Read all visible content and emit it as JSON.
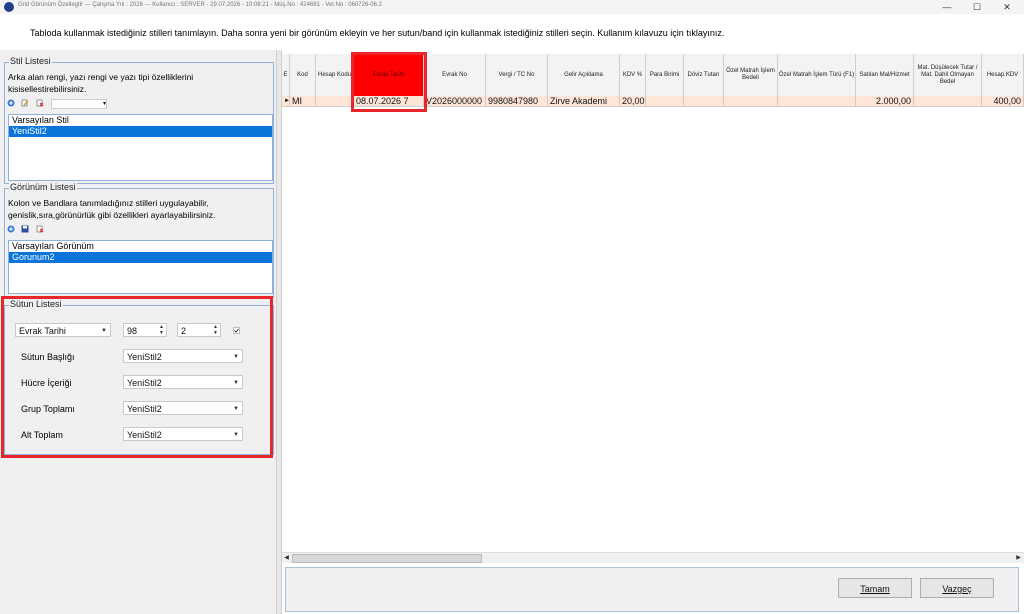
{
  "window": {
    "title": "Grid Görünüm Özellegtir  ---  Çalışma Yılı : 2026  ---  Kullanıcı : SERVER - 29.07.2026 - 10:08:21 - Müş.No : 424681 - Ver.No : 060726-06.2",
    "minimize": "—",
    "maximize": "☐",
    "close": "✕"
  },
  "instruction": "Tabloda kullanmak istediğiniz stilleri tanımlayın. Daha sonra  yeni bir görünüm ekleyin ve her sutun/band için kullanmak istediğiniz stilleri seçin. Kullanım kılavuzu için tıklayınız.",
  "stil_listesi": {
    "title": "Stil Listesi",
    "desc": "Arka alan rengi, yazı rengi ve yazı tipi özelliklerini kisisellestirebilirsiniz.",
    "items": [
      "Varsayılan Stil",
      "YeniStil2"
    ],
    "selected": "YeniStil2"
  },
  "gorunum_listesi": {
    "title": "Görünüm Listesi",
    "desc": "Kolon ve Bandlara tanımladığınız stilleri uygulayabilir, genislik,sıra,görünürlük gibi özellikleri ayarlayabilirsiniz.",
    "items": [
      "Varsayılan Görünüm",
      "Gorunum2"
    ],
    "selected": "Gorunum2"
  },
  "sutun_listesi": {
    "title": "Sütun Listesi",
    "column_select": "Evrak Tarihi",
    "width_value": "98",
    "order_value": "2",
    "fields": [
      {
        "label": "Sütun Başlığı",
        "value": "YeniStil2"
      },
      {
        "label": "Hücre İçeriği",
        "value": "YeniStil2"
      },
      {
        "label": "Grup Toplamı",
        "value": "YeniStil2"
      },
      {
        "label": "Alt Toplam",
        "value": "YeniStil2"
      }
    ]
  },
  "grid": {
    "columns": [
      "E",
      "Kod",
      "Hesap Kodu",
      "Evrak Tarihi",
      "Evrak No",
      "Vergi / TC No",
      "Gelir Açıklama",
      "KDV %",
      "Para Birimi",
      "Döviz Tutarı",
      "Özel Matrah İşlem Bedeli",
      "Özel Matrah İşlem Türü (F1)",
      "Satılan Mal/Hizmet",
      "Mat. Düşülecek Tutar / Mat. Dahil Olmayan Bedel",
      "Hesap.KDV"
    ],
    "row": [
      "MI",
      "",
      "08.07.2026 7",
      "V2026000000",
      "9980847980",
      "Zirve Akademi",
      "20,00",
      "",
      "",
      "",
      "",
      "2.000,00",
      "",
      "400,00"
    ],
    "row_pointer": "►"
  },
  "buttons": {
    "ok": "Tamam",
    "cancel": "Vazgeç"
  },
  "colors": {
    "highlight": "#e8262b",
    "selection": "#0a74d8",
    "row": "#fde6d8"
  }
}
